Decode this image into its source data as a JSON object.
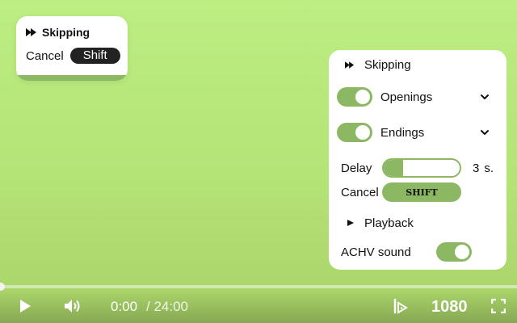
{
  "toast": {
    "title": "Skipping",
    "cancel_label": "Cancel",
    "key_label": "Shift",
    "icon": "fast-forward-icon",
    "progress_fraction": 1.0
  },
  "panel": {
    "header": {
      "label": "Skipping",
      "icon": "fast-forward-icon"
    },
    "openings": {
      "label": "Openings",
      "enabled": true
    },
    "endings": {
      "label": "Endings",
      "enabled": true
    },
    "delay": {
      "label": "Delay",
      "value": "3",
      "unit": "s.",
      "fill_fraction": 0.25
    },
    "cancel": {
      "label": "Cancel",
      "key": "SHIFT"
    },
    "playback": {
      "label": "Playback",
      "icon": "play-icon"
    },
    "achv": {
      "label": "ACHV sound",
      "enabled": true
    }
  },
  "player": {
    "time_current": "0:00",
    "time_separator_duration": "/ 24:00",
    "quality": "1080",
    "progress_fraction": 0
  },
  "colors": {
    "accent": "#8cb864",
    "background": "#bdee83"
  }
}
